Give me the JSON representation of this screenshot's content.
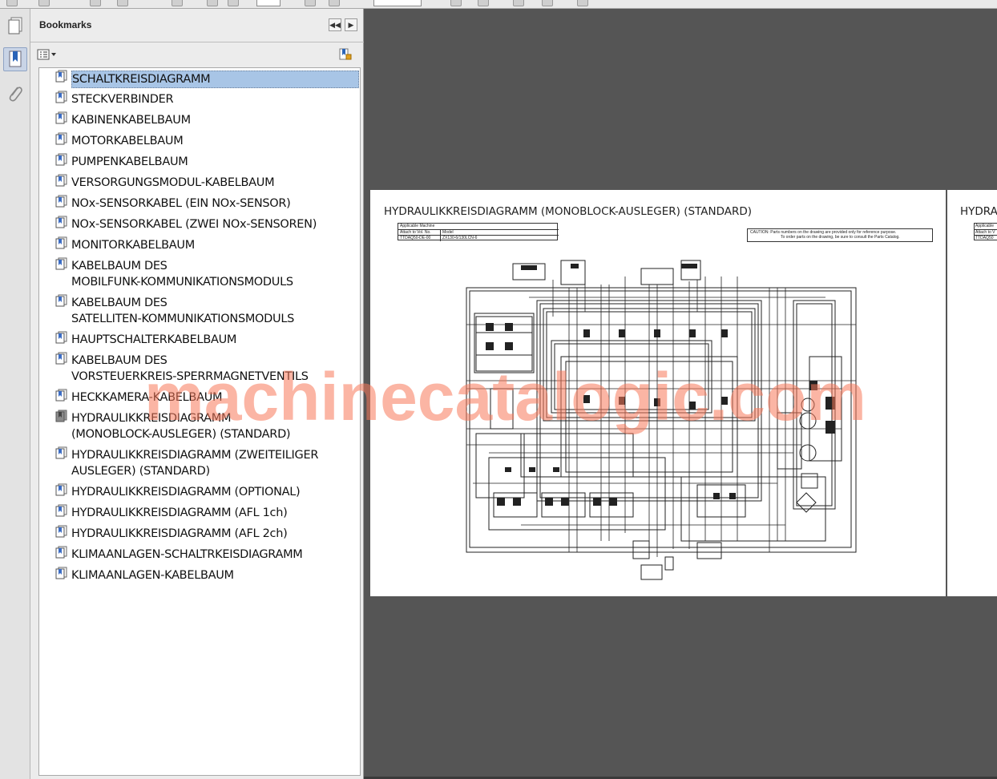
{
  "panel": {
    "title": "Bookmarks",
    "collapse_label": "◀◀",
    "next_label": "▶",
    "options_icon": "list-options-icon",
    "expand_icon": "bookmark-expand-icon"
  },
  "sidebar": {
    "tools": [
      "pages-icon",
      "bookmarks-icon",
      "attachments-icon"
    ]
  },
  "bookmarks": [
    {
      "label": "SCHALTKREISDIAGRAMM",
      "selected": true
    },
    {
      "label": "STECKVERBINDER"
    },
    {
      "label": "KABINENKABELBAUM"
    },
    {
      "label": "MOTORKABELBAUM"
    },
    {
      "label": "PUMPENKABELBAUM"
    },
    {
      "label": "VERSORGUNGSMODUL-KABELBAUM"
    },
    {
      "label": "NOx-SENSORKABEL (EIN NOx-SENSOR)"
    },
    {
      "label": "NOx-SENSORKABEL (ZWEI NOx-SENSOREN)"
    },
    {
      "label": "MONITORKABELBAUM"
    },
    {
      "label": "KABELBAUM DES\nMOBILFUNK-KOMMUNIKATIONSMODULS"
    },
    {
      "label": "KABELBAUM DES\nSATELLITEN-KOMMUNIKATIONSMODULS"
    },
    {
      "label": "HAUPTSCHALTERKABELBAUM"
    },
    {
      "label": "KABELBAUM DES\nVORSTEUERKREIS-SPERRMAGNETVENTILS"
    },
    {
      "label": "HECKKAMERA-KABELBAUM"
    },
    {
      "label": "HYDRAULIKKREISDIAGRAMM\n(MONOBLOCK-AUSLEGER) (STANDARD)",
      "current": true
    },
    {
      "label": "HYDRAULIKKREISDIAGRAMM (ZWEITEILIGER\nAUSLEGER) (STANDARD)"
    },
    {
      "label": "HYDRAULIKKREISDIAGRAMM (OPTIONAL)"
    },
    {
      "label": "HYDRAULIKKREISDIAGRAMM (AFL 1ch)"
    },
    {
      "label": "HYDRAULIKKREISDIAGRAMM (AFL 2ch)"
    },
    {
      "label": "KLIMAANLAGEN-SCHALTRKEISDIAGRAMM"
    },
    {
      "label": "KLIMAANLAGEN-KABELBAUM"
    }
  ],
  "document": {
    "page_title": "HYDRAULIKKREISDIAGRAMM (MONOBLOCK-AUSLEGER) (STANDARD)",
    "next_page_title": "HYDRA",
    "applicable_label": "Applicable Machine",
    "attach_label": "Attach to Vol. No.",
    "model_label": "Model",
    "attach_value": "TTDAQ50-DE-00",
    "model_value": "ZX130-6/130LCN-6",
    "next_applicable_label": "Applicable",
    "next_attach_label": "Attach to V",
    "next_attach_value": "TTDAQ50",
    "caution_line1": "CAUTION: Parts numbers on the drawing are provided only for reference purpose.",
    "caution_line2": "To order parts on the drawing, be sure to consult the Parts Catalog."
  },
  "watermark": "machinecatalogic.com"
}
